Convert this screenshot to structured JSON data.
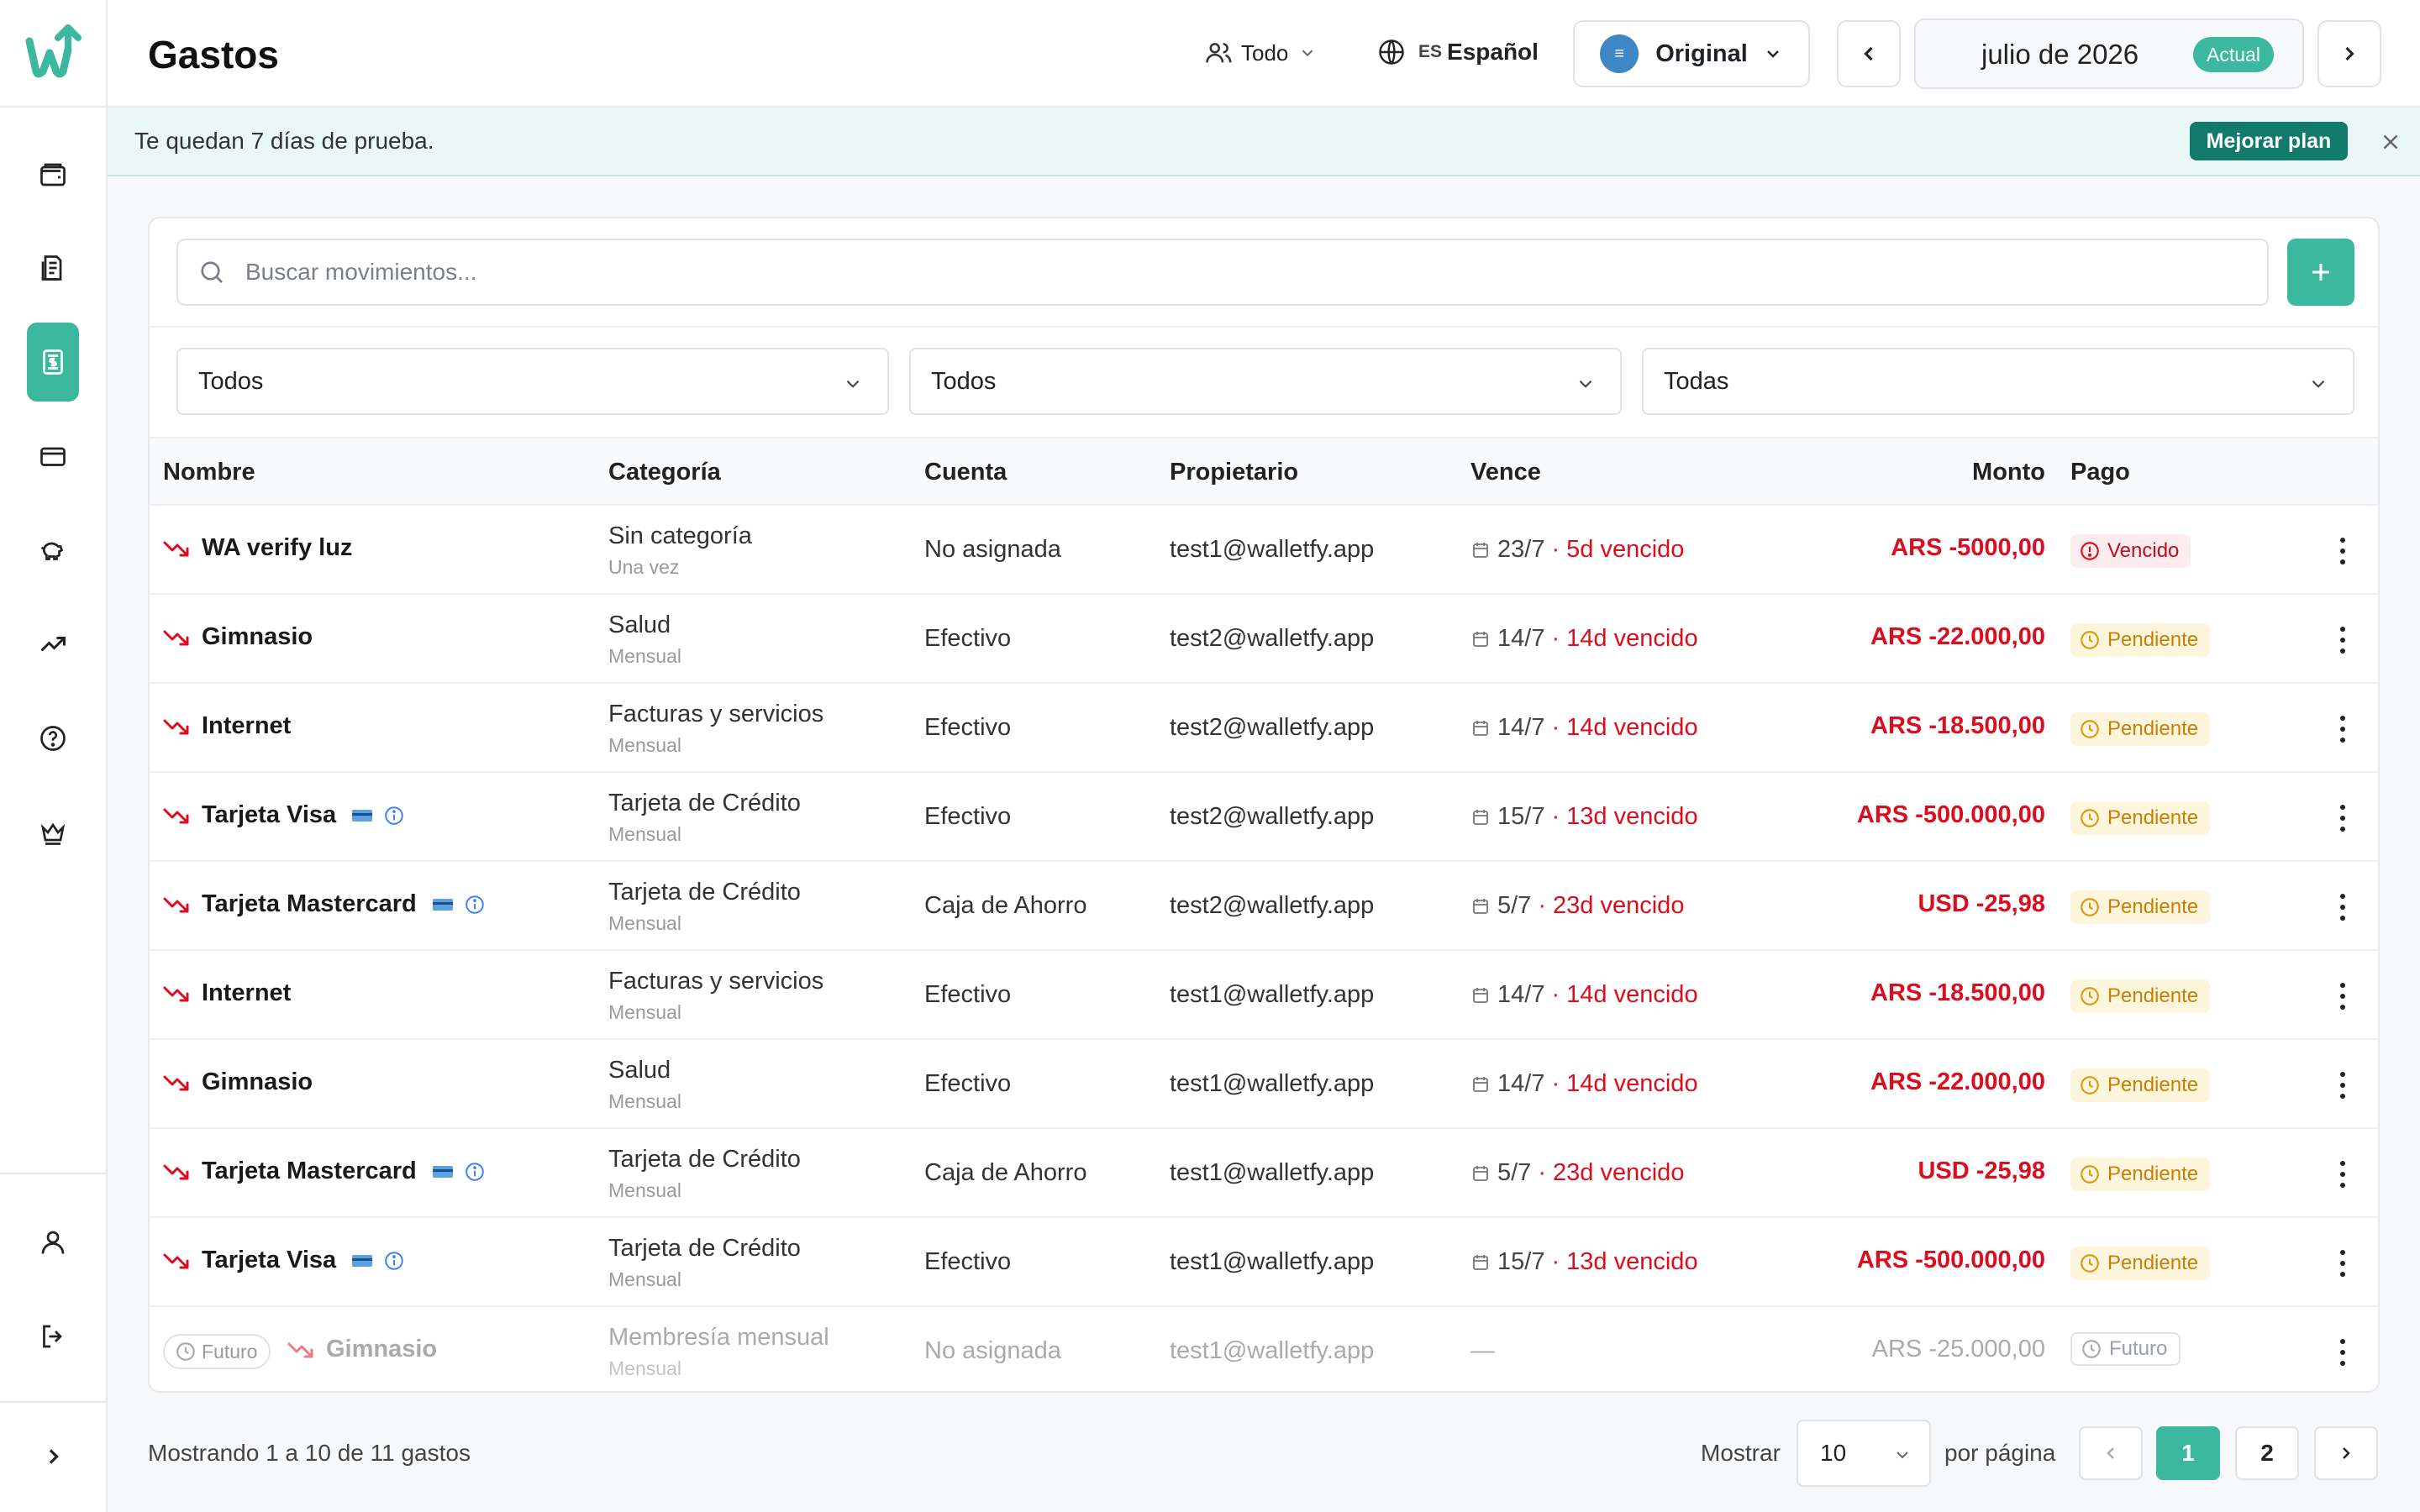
{
  "header": {
    "title": "Gastos",
    "people_filter": "Todo",
    "language_code": "ES",
    "language": "Español",
    "currency_mode": "Original",
    "month": "julio de 2026",
    "current_badge": "Actual"
  },
  "banner": {
    "text": "Te quedan 7 días de prueba.",
    "upgrade_label": "Mejorar plan"
  },
  "search": {
    "placeholder": "Buscar movimientos..."
  },
  "filters": [
    "Todos",
    "Todos",
    "Todas"
  ],
  "table": {
    "columns": [
      "Nombre",
      "Categoría",
      "Cuenta",
      "Propietario",
      "Vence",
      "Monto",
      "Pago"
    ],
    "rows": [
      {
        "name": "WA verify luz",
        "card": false,
        "category": "Sin categoría",
        "frequency": "Una vez",
        "account": "No asignada",
        "owner": "test1@walletfy.app",
        "date": "23/7",
        "overdue": "· 5d vencido",
        "amount": "ARS -5000,00",
        "status": "Vencido"
      },
      {
        "name": "Gimnasio",
        "card": false,
        "category": "Salud",
        "frequency": "Mensual",
        "account": "Efectivo",
        "owner": "test2@walletfy.app",
        "date": "14/7",
        "overdue": "· 14d vencido",
        "amount": "ARS -22.000,00",
        "status": "Pendiente"
      },
      {
        "name": "Internet",
        "card": false,
        "category": "Facturas y servicios",
        "frequency": "Mensual",
        "account": "Efectivo",
        "owner": "test2@walletfy.app",
        "date": "14/7",
        "overdue": "· 14d vencido",
        "amount": "ARS -18.500,00",
        "status": "Pendiente"
      },
      {
        "name": "Tarjeta Visa",
        "card": true,
        "category": "Tarjeta de Crédito",
        "frequency": "Mensual",
        "account": "Efectivo",
        "owner": "test2@walletfy.app",
        "date": "15/7",
        "overdue": "· 13d vencido",
        "amount": "ARS -500.000,00",
        "status": "Pendiente"
      },
      {
        "name": "Tarjeta Mastercard",
        "card": true,
        "category": "Tarjeta de Crédito",
        "frequency": "Mensual",
        "account": "Caja de Ahorro",
        "owner": "test2@walletfy.app",
        "date": "5/7",
        "overdue": "· 23d vencido",
        "amount": "USD -25,98",
        "status": "Pendiente"
      },
      {
        "name": "Internet",
        "card": false,
        "category": "Facturas y servicios",
        "frequency": "Mensual",
        "account": "Efectivo",
        "owner": "test1@walletfy.app",
        "date": "14/7",
        "overdue": "· 14d vencido",
        "amount": "ARS -18.500,00",
        "status": "Pendiente"
      },
      {
        "name": "Gimnasio",
        "card": false,
        "category": "Salud",
        "frequency": "Mensual",
        "account": "Efectivo",
        "owner": "test1@walletfy.app",
        "date": "14/7",
        "overdue": "· 14d vencido",
        "amount": "ARS -22.000,00",
        "status": "Pendiente"
      },
      {
        "name": "Tarjeta Mastercard",
        "card": true,
        "category": "Tarjeta de Crédito",
        "frequency": "Mensual",
        "account": "Caja de Ahorro",
        "owner": "test1@walletfy.app",
        "date": "5/7",
        "overdue": "· 23d vencido",
        "amount": "USD -25,98",
        "status": "Pendiente"
      },
      {
        "name": "Tarjeta Visa",
        "card": true,
        "category": "Tarjeta de Crédito",
        "frequency": "Mensual",
        "account": "Efectivo",
        "owner": "test1@walletfy.app",
        "date": "15/7",
        "overdue": "· 13d vencido",
        "amount": "ARS -500.000,00",
        "status": "Pendiente"
      }
    ],
    "future_row": {
      "pill": "Futuro",
      "name": "Gimnasio",
      "category": "Membresía mensual",
      "frequency": "Mensual",
      "account": "No asignada",
      "owner": "test1@walletfy.app",
      "date": "—",
      "amount": "ARS -25.000,00",
      "status": "Futuro"
    }
  },
  "footer": {
    "summary": "Mostrando 1 a 10 de 11 gastos",
    "show_label": "Mostrar",
    "page_size": "10",
    "per_page_label": "por página",
    "pages": [
      "1",
      "2"
    ]
  },
  "colors": {
    "accent": "#3bb89d",
    "danger": "#d90f1f",
    "pending": "#c87f05",
    "upgrade": "#117a6b"
  }
}
